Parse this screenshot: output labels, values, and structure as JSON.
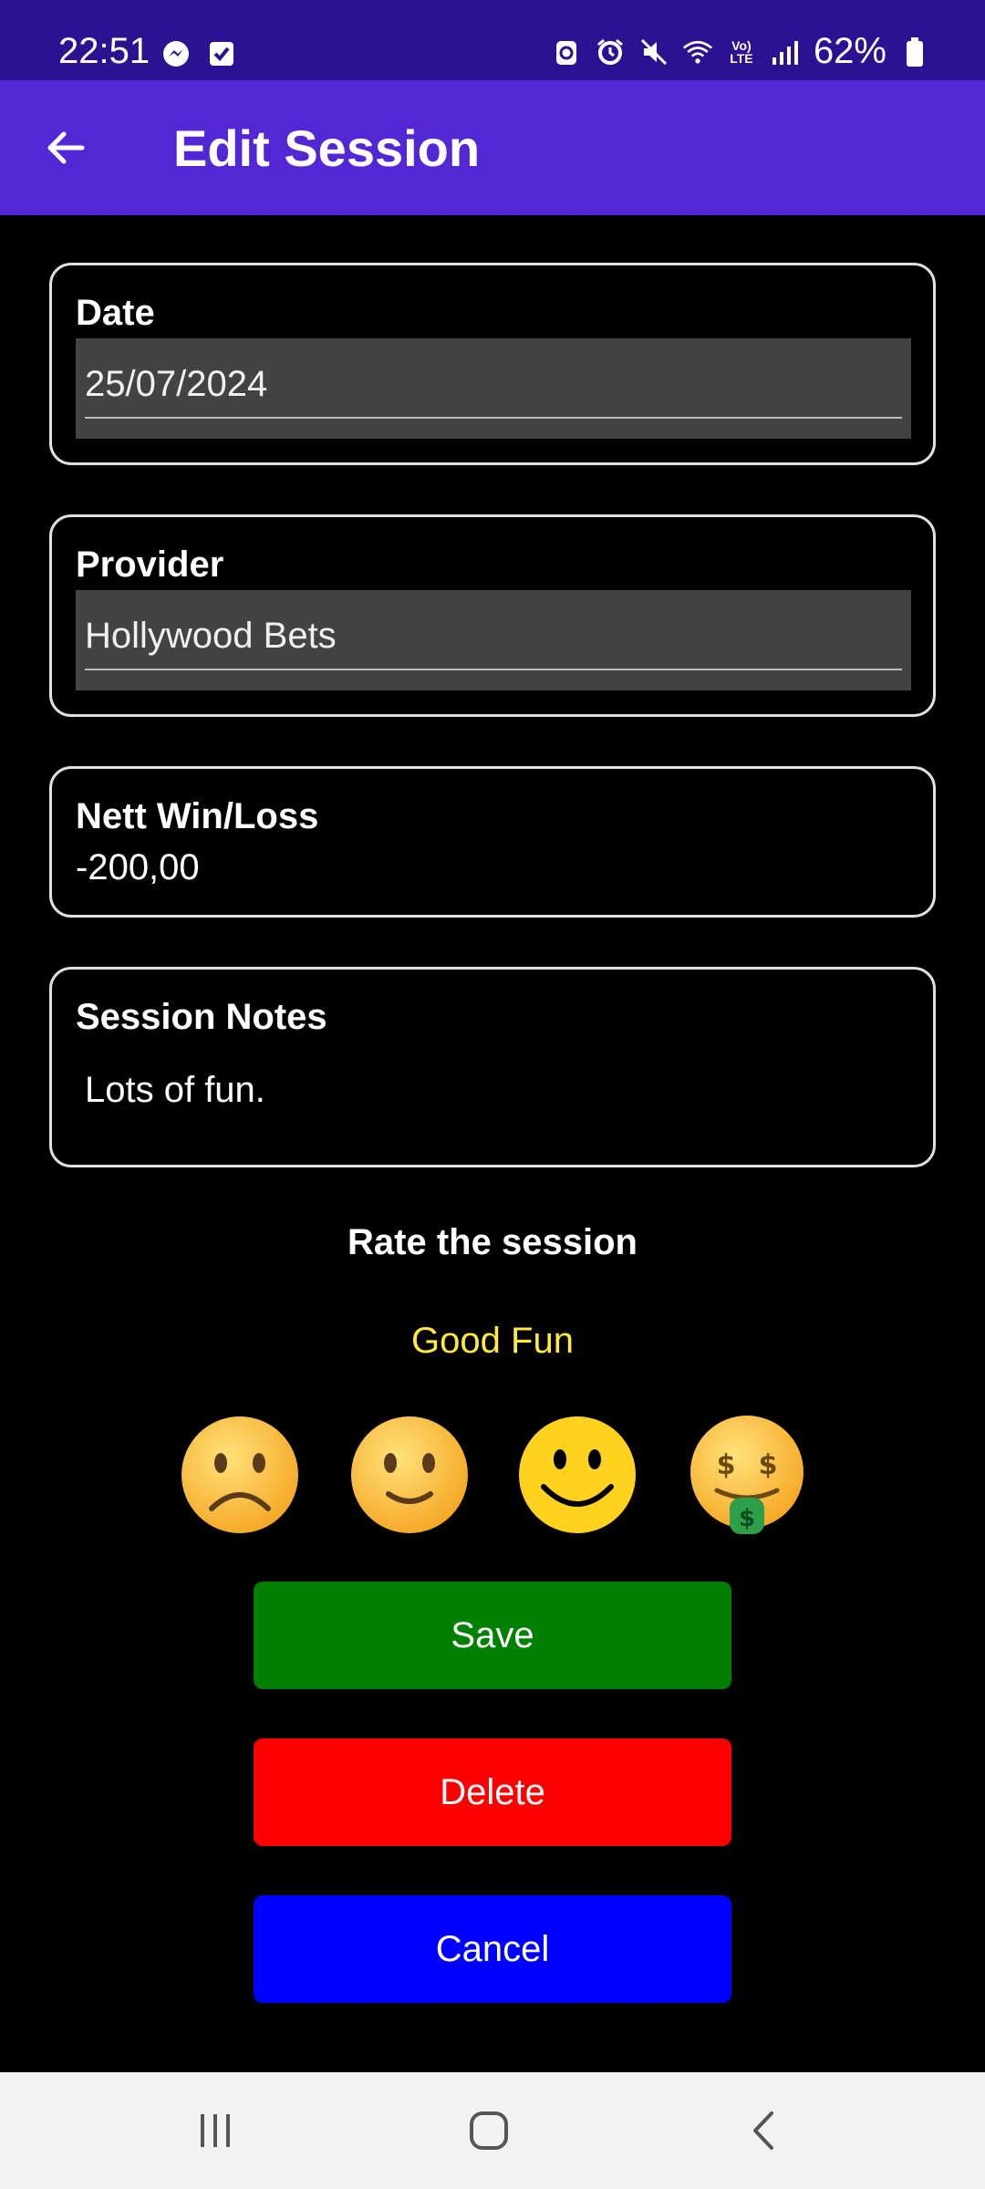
{
  "status_bar": {
    "time": "22:51",
    "battery": "62%",
    "left_icons": [
      "messenger-icon",
      "checkbox-icon"
    ],
    "right_icons": [
      "sync-icon",
      "alarm-icon",
      "mute-icon",
      "wifi-icon",
      "volte-icon",
      "signal-icon",
      "battery-icon"
    ]
  },
  "app_bar": {
    "title": "Edit Session",
    "background": "#5128d4"
  },
  "fields": {
    "date": {
      "label": "Date",
      "value": "25/07/2024"
    },
    "provider": {
      "label": "Provider",
      "value": "Hollywood Bets"
    },
    "nett": {
      "label": "Nett Win/Loss",
      "value": "-200,00"
    },
    "notes": {
      "label": "Session Notes",
      "value": "Lots of fun."
    }
  },
  "rating": {
    "title": "Rate the session",
    "selected_label": "Good Fun",
    "selected_label_color": "#ffeb3b",
    "options": [
      "frowning-face-icon",
      "slightly-smiling-face-icon",
      "smiling-face-icon",
      "money-mouth-face-icon"
    ],
    "selected_index": 2
  },
  "buttons": {
    "save": {
      "label": "Save",
      "color": "#008000"
    },
    "delete": {
      "label": "Delete",
      "color": "#ff0000"
    },
    "cancel": {
      "label": "Cancel",
      "color": "#0000ff"
    }
  },
  "nav": [
    "recent-apps-icon",
    "home-icon",
    "back-icon"
  ]
}
